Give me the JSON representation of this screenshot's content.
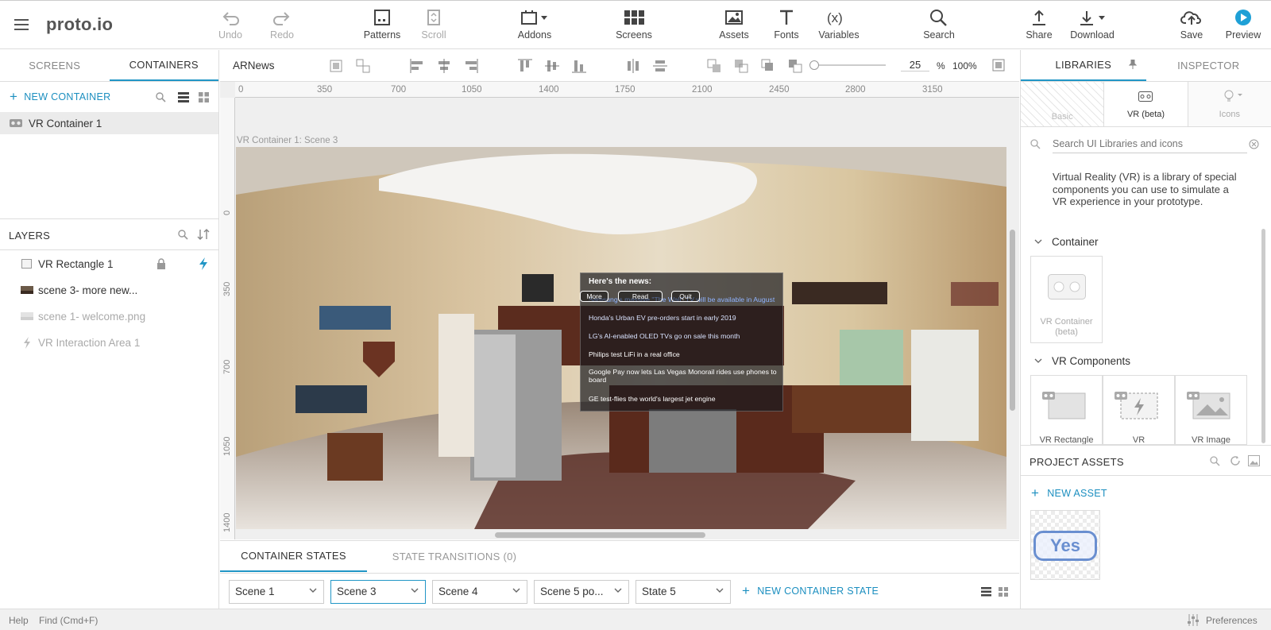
{
  "app": {
    "logo": "proto.io"
  },
  "toolbar": {
    "undo": "Undo",
    "redo": "Redo",
    "patterns": "Patterns",
    "scroll": "Scroll",
    "addons": "Addons",
    "screens": "Screens",
    "assets": "Assets",
    "fonts": "Fonts",
    "variables": "Variables",
    "search": "Search",
    "share": "Share",
    "download": "Download",
    "save": "Save",
    "preview": "Preview"
  },
  "left": {
    "tabs": [
      "SCREENS",
      "CONTAINERS"
    ],
    "new_container": "NEW CONTAINER",
    "container_item": "VR Container 1",
    "layers_title": "LAYERS",
    "layers": [
      "VR Rectangle 1",
      "scene 3- more new...",
      "scene 1- welcome.png",
      "VR Interaction Area 1"
    ]
  },
  "canvas": {
    "title": "ARNews",
    "zoom_value": "25",
    "zoom_pct": "%",
    "zoom_100": "100%",
    "ruler_h": [
      "0",
      "350",
      "700",
      "1050",
      "1400",
      "1750",
      "2100",
      "2450",
      "2800",
      "3150"
    ],
    "ruler_v": [
      "0",
      "350",
      "700",
      "1050",
      "1400"
    ],
    "scene_label": "VR Container 1: Scene 3"
  },
  "news": {
    "heading": "Here's the news:",
    "items": [
      "Samsung's massive \"The Wall\" TV will be available in August",
      "Honda's Urban EV pre-orders start in early 2019",
      "LG's AI-enabled OLED TVs go on sale this month",
      "Philips test LiFi in a real office",
      "Google Pay now lets Las Vegas Monorail rides use phones to board",
      "GE test-flies the world's largest jet engine"
    ],
    "buttons": [
      "More",
      "Read",
      "Quit"
    ]
  },
  "bottom": {
    "tabs": [
      "CONTAINER STATES",
      "STATE TRANSITIONS (0)"
    ],
    "states": [
      "Scene 1",
      "Scene 3",
      "Scene 4",
      "Scene 5 po...",
      "State 5"
    ],
    "new_state": "NEW CONTAINER STATE"
  },
  "right": {
    "tabs": [
      "LIBRARIES",
      "INSPECTOR"
    ],
    "lib_tabs": [
      "Basic",
      "VR (beta)",
      "Icons"
    ],
    "search_placeholder": "Search UI Libraries and icons",
    "description": "Virtual Reality (VR) is a library of special components you can use to simulate a VR experience in your prototype.",
    "section_container": "Container",
    "container_card": "VR Container (beta)",
    "section_components": "VR Components",
    "components": [
      "VR Rectangle",
      "VR",
      "VR Image"
    ],
    "project_assets": "PROJECT ASSETS",
    "new_asset": "NEW ASSET",
    "asset_text": "Yes"
  },
  "status": {
    "help": "Help",
    "find": "Find (Cmd+F)",
    "preferences": "Preferences"
  },
  "colors": {
    "accent": "#2196c6",
    "preview": "#1ea0d6"
  }
}
